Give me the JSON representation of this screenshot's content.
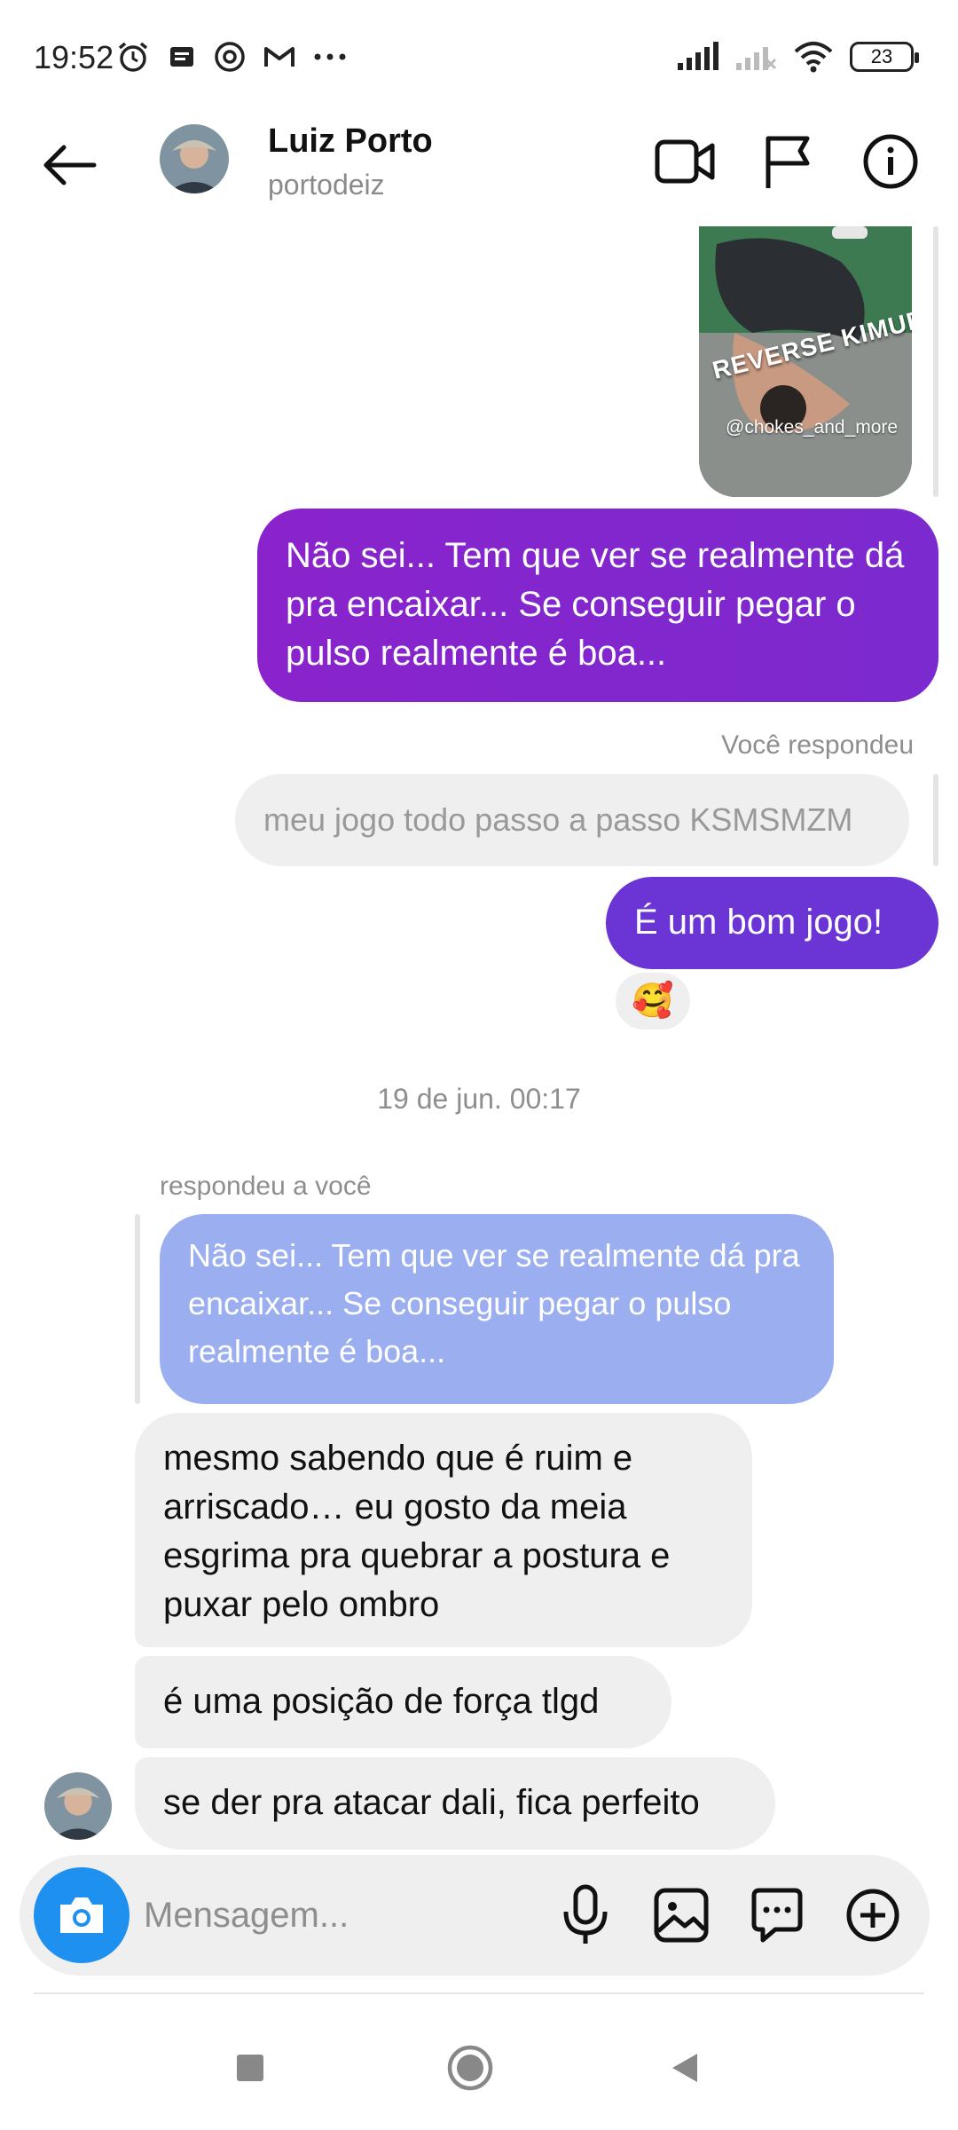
{
  "status_bar": {
    "time": "19:52",
    "battery": "23",
    "left_icons": [
      "alarm-icon",
      "notification-icon",
      "threads-icon",
      "gmail-icon",
      "more-dots-icon"
    ],
    "right_icons": [
      "signal-icon",
      "signal-2-icon",
      "wifi-icon",
      "battery-icon"
    ]
  },
  "header": {
    "name": "Luiz Porto",
    "username": "portodeiz",
    "actions": [
      "video-call-icon",
      "flag-icon",
      "info-icon"
    ]
  },
  "messages": {
    "media": {
      "title": "REVERSE KIMURA",
      "handle": "@chokes_and_more"
    },
    "out1": "Não sei... Tem que ver se realmente dá pra encaixar... Se conseguir pegar o pulso realmente  é boa...",
    "you_replied": "Você respondeu",
    "quoted_out": "meu jogo todo passo a passo KSMSMZM",
    "out2": "É um bom jogo!",
    "reaction": "🥰",
    "timestamp": "19 de jun. 00:17",
    "replied_to_you": "respondeu a você",
    "quoted_in": "Não sei... Tem que ver se realmente dá pra encaixar... Se conseguir pegar o pulso realmente  é boa...",
    "in1": "mesmo sabendo que é ruim e arriscado… eu gosto da meia esgrima pra quebrar a postura e puxar pelo ombro",
    "in2": "é uma posição de força tlgd",
    "in3": "se der pra atacar dali, fica perfeito"
  },
  "composer": {
    "placeholder": "Mensagem...",
    "icons": [
      "camera-icon",
      "microphone-icon",
      "gallery-icon",
      "sticker-icon",
      "plus-icon"
    ]
  },
  "colors": {
    "outgoing_purple": "#8a23cc",
    "outgoing_violet": "#6a35d4",
    "quoted_blue": "#9aaef0",
    "incoming_gray": "#efefef",
    "camera_blue": "#1e90f0"
  }
}
